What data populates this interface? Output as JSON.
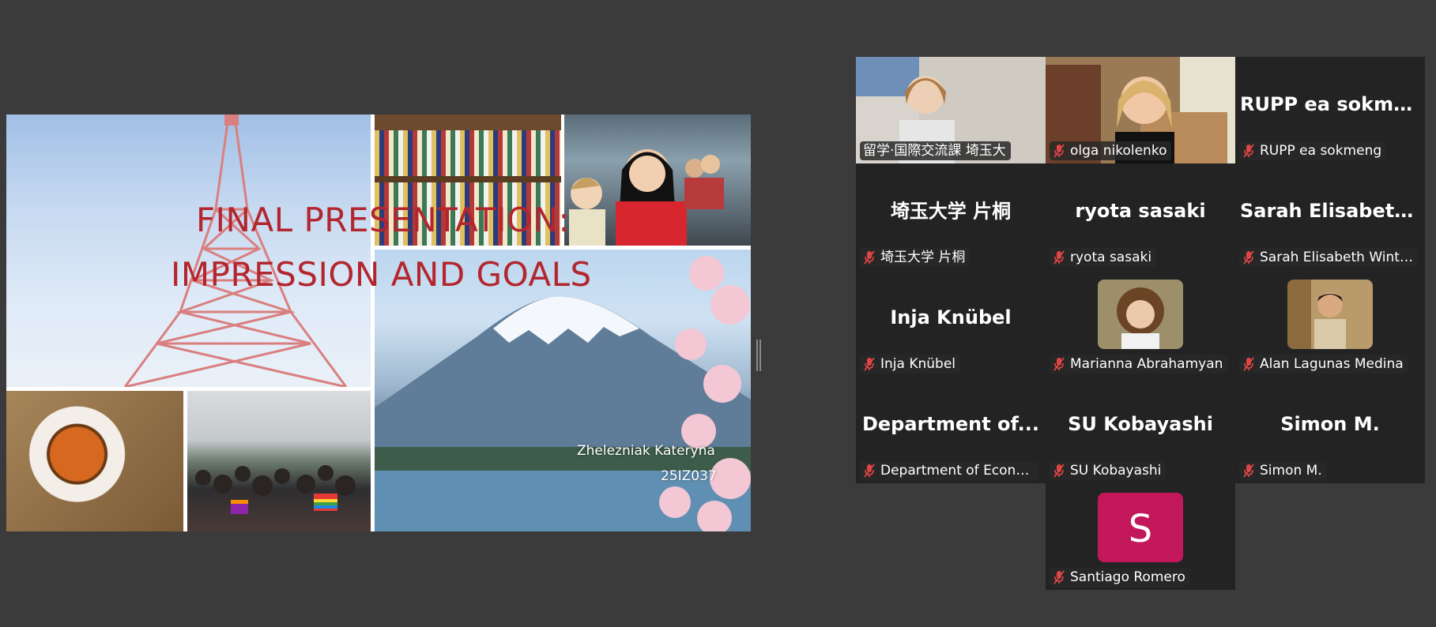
{
  "slide": {
    "title_line1": "FINAL PRESENTATION:",
    "title_line2": "IMPRESSION AND GOALS",
    "author": "Zhelezniak Kateryna",
    "student_id": "25IZ037"
  },
  "gallery": {
    "accent_color": "#23d96b",
    "muted_color": "#e04545",
    "participants": [
      {
        "display": "video",
        "name": "留学·国際交流課 埼玉大",
        "active": true,
        "muted": false
      },
      {
        "display": "video",
        "name": "olga nikolenko",
        "muted": true
      },
      {
        "display": "text",
        "big": "RUPP ea sokme...",
        "name": "RUPP ea sokmeng",
        "muted": true
      },
      {
        "display": "text",
        "big": "埼玉大学 片桐",
        "name": "埼玉大学 片桐",
        "muted": true
      },
      {
        "display": "text",
        "big": "ryota sasaki",
        "name": "ryota sasaki",
        "muted": true
      },
      {
        "display": "text",
        "big": "Sarah  Elisabeth...",
        "name": "Sarah Elisabeth Winter...",
        "muted": true
      },
      {
        "display": "text",
        "big": "Inja Knübel",
        "name": "Inja Knübel",
        "muted": true
      },
      {
        "display": "photo",
        "name": "Marianna Abrahamyan",
        "muted": true
      },
      {
        "display": "photo",
        "name": "Alan Lagunas Medina",
        "muted": true
      },
      {
        "display": "text",
        "big": "Department  of...",
        "name": "Department of Econo...",
        "muted": true
      },
      {
        "display": "text",
        "big": "SU Kobayashi",
        "name": "SU Kobayashi",
        "muted": true
      },
      {
        "display": "text",
        "big": "Simon M.",
        "name": "Simon M.",
        "muted": true
      },
      {
        "display": "avatar",
        "initial": "S",
        "avatar_color": "#c2185b",
        "name": "Santiago Romero",
        "muted": true
      }
    ]
  }
}
